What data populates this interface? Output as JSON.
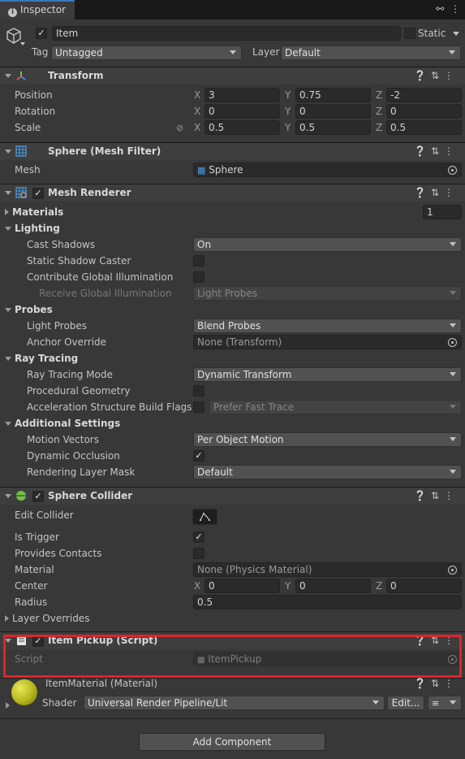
{
  "tab": {
    "title": "Inspector"
  },
  "object": {
    "name": "Item",
    "static_label": "Static",
    "tag_label": "Tag",
    "tag_value": "Untagged",
    "layer_label": "Layer",
    "layer_value": "Default"
  },
  "transform": {
    "title": "Transform",
    "position_label": "Position",
    "rotation_label": "Rotation",
    "scale_label": "Scale",
    "axes": [
      "X",
      "Y",
      "Z"
    ],
    "position": [
      "3",
      "0.75",
      "-2"
    ],
    "rotation": [
      "0",
      "0",
      "0"
    ],
    "scale": [
      "0.5",
      "0.5",
      "0.5"
    ]
  },
  "mesh_filter": {
    "title": "Sphere (Mesh Filter)",
    "mesh_label": "Mesh",
    "mesh_value": "Sphere"
  },
  "mesh_renderer": {
    "title": "Mesh Renderer",
    "materials_label": "Materials",
    "materials_count": "1",
    "lighting_label": "Lighting",
    "cast_shadows_label": "Cast Shadows",
    "cast_shadows_value": "On",
    "static_shadow_label": "Static Shadow Caster",
    "contribute_gi_label": "Contribute Global Illumination",
    "receive_gi_label": "Receive Global Illumination",
    "receive_gi_value": "Light Probes",
    "probes_label": "Probes",
    "light_probes_label": "Light Probes",
    "light_probes_value": "Blend Probes",
    "anchor_label": "Anchor Override",
    "anchor_value": "None (Transform)",
    "ray_tracing_label": "Ray Tracing",
    "rt_mode_label": "Ray Tracing Mode",
    "rt_mode_value": "Dynamic Transform",
    "procedural_label": "Procedural Geometry",
    "accel_label": "Acceleration Structure Build Flags",
    "accel_value": "Prefer Fast Trace",
    "additional_label": "Additional Settings",
    "motion_label": "Motion Vectors",
    "motion_value": "Per Object Motion",
    "occlusion_label": "Dynamic Occlusion",
    "layer_mask_label": "Rendering Layer Mask",
    "layer_mask_value": "Default"
  },
  "sphere_collider": {
    "title": "Sphere Collider",
    "edit_label": "Edit Collider",
    "trigger_label": "Is Trigger",
    "contacts_label": "Provides Contacts",
    "material_label": "Material",
    "material_value": "None (Physics Material)",
    "center_label": "Center",
    "center": [
      "0",
      "0",
      "0"
    ],
    "radius_label": "Radius",
    "radius_value": "0.5",
    "overrides_label": "Layer Overrides"
  },
  "item_pickup": {
    "title": "Item Pickup (Script)",
    "script_label": "Script",
    "script_value": "ItemPickup"
  },
  "material": {
    "title": "ItemMaterial (Material)",
    "shader_label": "Shader",
    "shader_value": "Universal Render Pipeline/Lit",
    "edit_label": "Edit..."
  },
  "footer": {
    "add_component": "Add Component"
  },
  "colors": {
    "highlight": "#e0242a",
    "accent": "#3a79bb"
  }
}
